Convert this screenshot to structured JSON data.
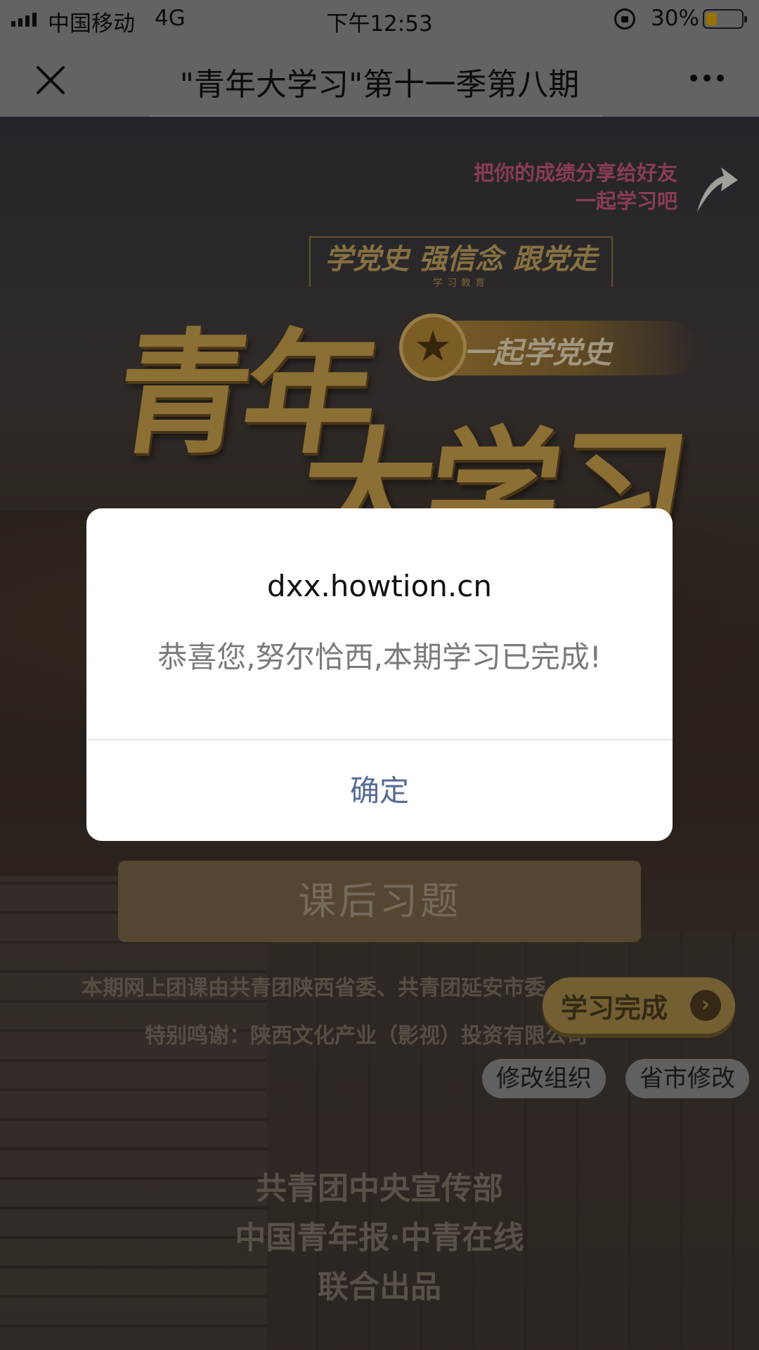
{
  "status_bar": {
    "carrier": "中国移动",
    "network": "4G",
    "time": "下午12:53",
    "battery_percent": "30%",
    "battery_level": 0.3,
    "battery_color": "#d9a400"
  },
  "nav": {
    "title": "\"青年大学习\"第十一季第八期",
    "close_icon": "close-icon",
    "more_icon": "more-icon"
  },
  "page": {
    "share_hint_line1": "把你的成绩分享给好友",
    "share_hint_line2": "一起学习吧",
    "slogan": "学党史 强信念 跟党走",
    "slogan_sub": "学习教育",
    "title_line1": "青年",
    "title_line2": "大学习",
    "badge_text": "一起学党史",
    "quiz_button": "课后习题",
    "credit_line1": "本期网上团课由共青团陕西省委、共青团延安市委",
    "credit_line2": "特别鸣谢：陕西文化产业（影视）投资有限公司",
    "done_button": "学习完成",
    "chip_org": "修改组织",
    "chip_province": "省市修改",
    "footer_line1": "共青团中央宣传部",
    "footer_line2": "中国青年报·中青在线",
    "footer_line3": "联合出品"
  },
  "dialog": {
    "title": "dxx.howtion.cn",
    "message": "恭喜您,努尔恰西,本期学习已完成!",
    "confirm": "确定",
    "confirm_color": "#576b95"
  }
}
